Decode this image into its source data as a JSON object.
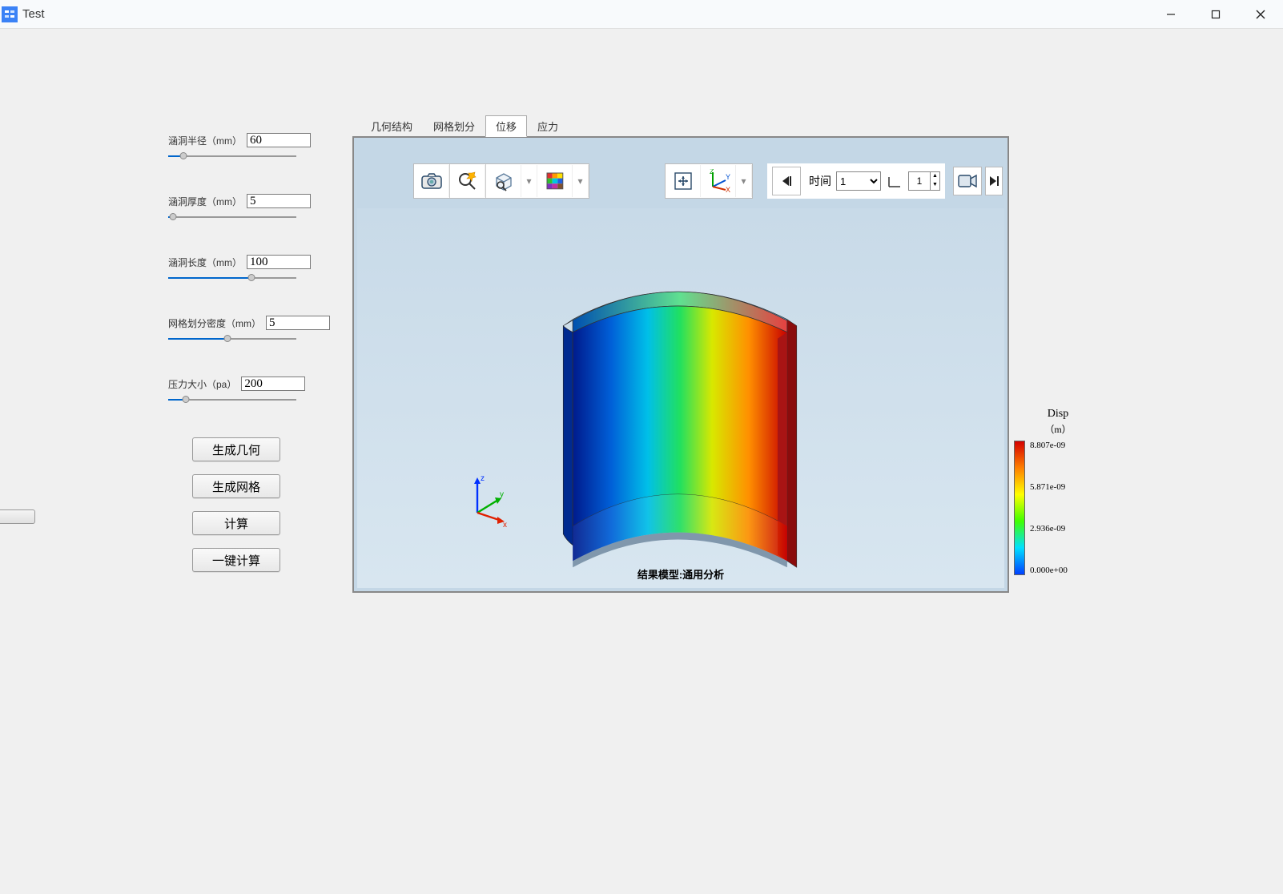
{
  "window": {
    "title": "Test"
  },
  "params": {
    "radius": {
      "label": "涵洞半径（mm）",
      "value": "60",
      "slider_pct": 12
    },
    "thickness": {
      "label": "涵洞厚度（mm）",
      "value": "5",
      "slider_pct": 4
    },
    "length": {
      "label": "涵洞长度（mm）",
      "value": "100",
      "slider_pct": 65
    },
    "mesh": {
      "label": "网格划分密度（mm）",
      "value": "5",
      "slider_pct": 46
    },
    "pressure": {
      "label": "压力大小（pa）",
      "value": "200",
      "slider_pct": 14
    }
  },
  "buttons": {
    "gen_geom": "生成几何",
    "gen_mesh": "生成网格",
    "compute": "计算",
    "one_click": "一键计算"
  },
  "tabs": {
    "geometry": "几何结构",
    "mesh": "网格划分",
    "displacement": "位移",
    "stress": "应力",
    "active": "displacement"
  },
  "toolbar": {
    "time_label": "时间",
    "time_value": "1",
    "frame_value": "1"
  },
  "viewer": {
    "result_label": "结果模型:通用分析"
  },
  "legend": {
    "title": "Disp",
    "unit": "（m）",
    "max": "8.807e-09",
    "q2": "5.871e-09",
    "q1": "2.936e-09",
    "min": "0.000e+00"
  },
  "icons": {
    "camera": "camera-icon",
    "zoom": "zoom-icon",
    "view": "view-icon",
    "colormap": "colormap-icon",
    "fit": "fit-icon",
    "axes": "axes-icon",
    "step_back": "step-back-icon",
    "video": "video-icon",
    "step_fwd": "step-forward-icon"
  }
}
